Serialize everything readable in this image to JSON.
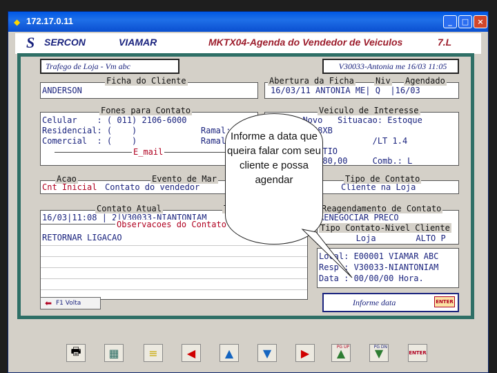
{
  "window": {
    "title": "172.17.0.11",
    "buttons": [
      "_",
      "□",
      "×"
    ]
  },
  "header": {
    "brand": "SERCON",
    "company": "VIAMAR",
    "screen": "MKTX04-Agenda do Vendedor de Veiculos",
    "version": "7.L"
  },
  "top": {
    "left_label": "Trafego de Loja - Vm abc",
    "right_label": "V30033-Antonia me 16/03 11:05"
  },
  "ficha": {
    "title": "Ficha do Cliente",
    "value": "ANDERSON"
  },
  "abertura": {
    "title": "Abertura da Ficha",
    "niv": "Niv",
    "agendado": "Agendado",
    "value": "16/03/11 ANTONIA ME| Q  |16/03"
  },
  "fones": {
    "title": "Fones para Contato",
    "rows": [
      "Celular    : ( 011) 2106-6000",
      "Residencial: (    )",
      "Comercial  : (    )"
    ],
    "ramal1": "Ramal:",
    "ramal2": "Ramal:",
    "email": "E_mail"
  },
  "veiculo": {
    "title": "Veiculo de Interesse",
    "rows": [
      ": Novo   Situacao: Estoque",
      ": 5B48XB",
      "AGILE           /LT 1.4",
      "EGE ARTIO",
      "  37.480,00     Comb.: L"
    ]
  },
  "acao": {
    "title1": "Acao",
    "title2": "Evento de Mar",
    "cell1": "Cnt Inicial",
    "cell2": "Contato do vendedor"
  },
  "tipo": {
    "title": "Tipo de Contato",
    "value": "Cliente na Loja"
  },
  "contato": {
    "title": "Contato Atual",
    "t": "T",
    "line": "16/03|11:08 | 2|V30033-NIANTONIAM",
    "obs_title": "Observacoes do Contato",
    "obs": "RETORNAR LIGACAO"
  },
  "reagend": {
    "title": "Reagendamento de Contato",
    "line1": "RENEGOCIAR PRECO",
    "line2": "Tipo Contato-Nivel Cliente",
    "line3": "   Loja        ALTO P",
    "local": "Local: E00001 VIAMAR ABC",
    "resp": "Resp : V30033-NIANTONIAM",
    "data": "Data : 00/00/00 Hora."
  },
  "bubble": {
    "text": "Informe a data que queira falar com seu cliente e possa agendar"
  },
  "footer": {
    "f1": "F1 Volta",
    "status": "Informe data",
    "key": "ENTER"
  },
  "toolbar": {
    "items": [
      "printer",
      "calculator",
      "stack",
      "left-arrow",
      "up-arrow",
      "down-arrow",
      "right-arrow",
      "page-up",
      "page-down",
      "enter"
    ],
    "pgup": "PG UP",
    "pgdn": "PG DN",
    "enter": "ENTER"
  }
}
